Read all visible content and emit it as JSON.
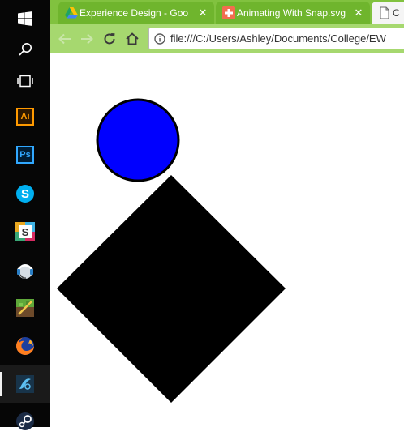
{
  "taskbar": {
    "items": [
      {
        "name": "start-button",
        "icon": "windows-logo-icon"
      },
      {
        "name": "search-button",
        "icon": "search-icon"
      },
      {
        "name": "task-view-button",
        "icon": "task-view-icon"
      },
      {
        "name": "illustrator",
        "icon": "illustrator-icon",
        "label": "Ai"
      },
      {
        "name": "photoshop",
        "icon": "photoshop-icon",
        "label": "Ps"
      },
      {
        "name": "skype",
        "icon": "skype-icon",
        "label": "S"
      },
      {
        "name": "slack",
        "icon": "slack-icon",
        "label": "S"
      },
      {
        "name": "headset-app",
        "icon": "headset-icon"
      },
      {
        "name": "minecraft",
        "icon": "minecraft-icon"
      },
      {
        "name": "firefox",
        "icon": "firefox-icon"
      },
      {
        "name": "chrome-app",
        "icon": "browser-app-icon",
        "active": true
      },
      {
        "name": "steam",
        "icon": "steam-icon"
      }
    ]
  },
  "browser": {
    "tabs": [
      {
        "title": "Experience Design - Goo",
        "icon": "google-drive-icon",
        "close": "✕"
      },
      {
        "title": "Animating With Snap.svg",
        "icon": "medical-cross-icon",
        "close": "✕"
      },
      {
        "title": "C",
        "icon": "document-icon",
        "active": true
      }
    ],
    "address": "file:///C:/Users/Ashley/Documents/College/EW"
  },
  "colors": {
    "tabstrip": "#81c23f",
    "toolbar": "#a6d86f",
    "circle_fill": "#0000ff",
    "diamond_fill": "#000000"
  }
}
